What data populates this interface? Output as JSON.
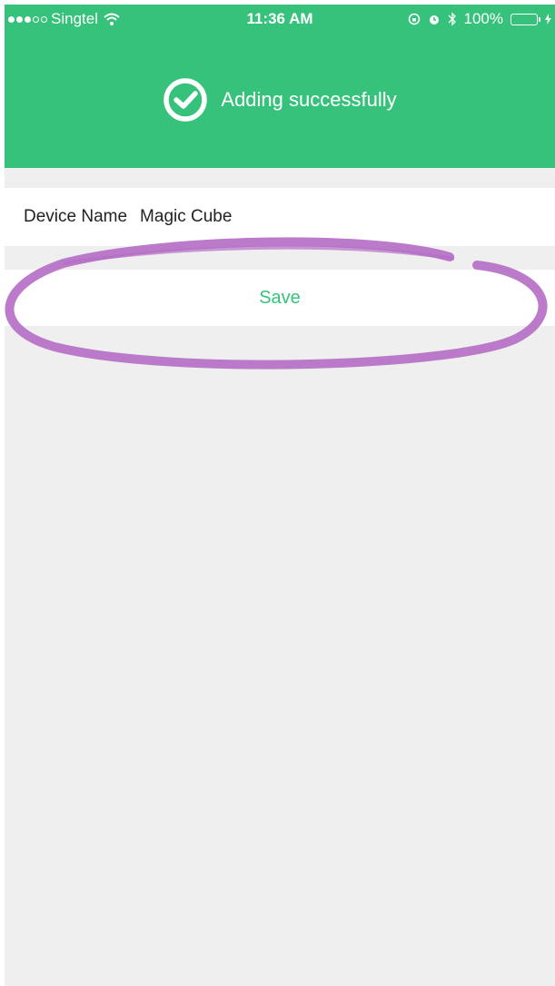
{
  "status_bar": {
    "carrier": "Singtel",
    "time": "11:36 AM",
    "battery": "100%",
    "signal_bars_filled": 3,
    "signal_bars_total": 5
  },
  "banner": {
    "message": "Adding successfully",
    "icon": "check-circle-icon"
  },
  "device": {
    "label": "Device Name",
    "value": "Magic Cube"
  },
  "actions": {
    "save_label": "Save"
  },
  "colors": {
    "brand_green": "#36c27b",
    "background": "#efefef",
    "annotation_purple": "#b56fc6"
  }
}
